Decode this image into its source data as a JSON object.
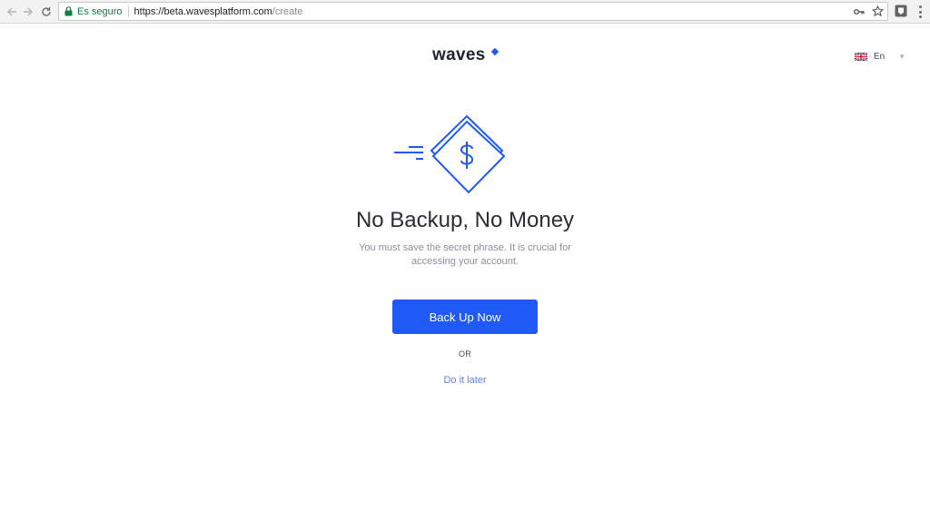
{
  "browser": {
    "secure_label": "Es seguro",
    "url_host": "https://beta.wavesplatform.com",
    "url_path": "/create",
    "icons": [
      "back-arrow-icon",
      "forward-arrow-icon",
      "reload-icon",
      "lock-icon",
      "key-icon",
      "star-icon",
      "extension-icon",
      "menu-icon"
    ]
  },
  "header": {
    "logo_text": "waves",
    "language": "En",
    "language_flag": "uk-flag-icon"
  },
  "main": {
    "title": "No Backup, No Money",
    "subtitle": "You must save the secret phrase. It is crucial for accessing your account.",
    "primary_button": "Back Up Now",
    "or_label": "OR",
    "secondary_link": "Do it later"
  },
  "colors": {
    "accent": "#1f5af6",
    "link": "#5a81ea",
    "title": "#2b2d33",
    "subtitle": "#8b8f99",
    "secure": "#0b8043"
  }
}
